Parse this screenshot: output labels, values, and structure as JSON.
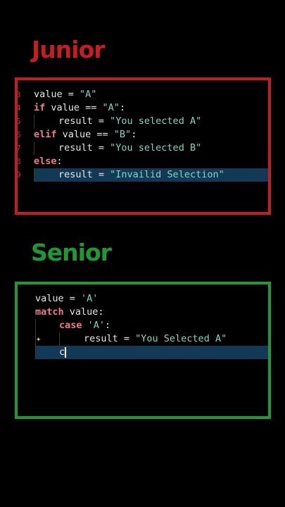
{
  "colors": {
    "junior": "#c61d25",
    "senior": "#1e9a35",
    "highlight": "#123a56"
  },
  "junior": {
    "heading": "Junior",
    "lines": [
      {
        "tokens": [
          {
            "t": "value",
            "c": "var"
          },
          {
            "t": " = ",
            "c": "op"
          },
          {
            "t": "\"A\"",
            "c": "str"
          }
        ]
      },
      {
        "tokens": [
          {
            "t": "if",
            "c": "kw"
          },
          {
            "t": " value == ",
            "c": "var"
          },
          {
            "t": "\"A\"",
            "c": "str"
          },
          {
            "t": ":",
            "c": "punct"
          }
        ]
      },
      {
        "tokens": [
          {
            "t": "result = ",
            "c": "var"
          },
          {
            "t": "\"You selected A\"",
            "c": "str"
          }
        ]
      },
      {
        "tokens": [
          {
            "t": "elif",
            "c": "kw"
          },
          {
            "t": " value == ",
            "c": "var"
          },
          {
            "t": "\"B\"",
            "c": "str"
          },
          {
            "t": ":",
            "c": "punct"
          }
        ]
      },
      {
        "tokens": [
          {
            "t": "result = ",
            "c": "var"
          },
          {
            "t": "\"You selected B\"",
            "c": "str"
          }
        ]
      },
      {
        "tokens": [
          {
            "t": "else",
            "c": "kw"
          },
          {
            "t": ":",
            "c": "punct"
          }
        ]
      },
      {
        "tokens": [
          {
            "t": "result = ",
            "c": "var"
          },
          {
            "t": "\"Invailid Selection\"",
            "c": "str"
          }
        ]
      }
    ]
  },
  "senior": {
    "heading": "Senior",
    "lines": [
      {
        "tokens": [
          {
            "t": "value",
            "c": "var"
          },
          {
            "t": " = ",
            "c": "op"
          },
          {
            "t": "'A'",
            "c": "str"
          }
        ]
      },
      {
        "tokens": [
          {
            "t": "match",
            "c": "kw"
          },
          {
            "t": " value:",
            "c": "var"
          }
        ]
      },
      {
        "tokens": [
          {
            "t": "case",
            "c": "kw"
          },
          {
            "t": " ",
            "c": "var"
          },
          {
            "t": "'A'",
            "c": "str"
          },
          {
            "t": ":",
            "c": "punct"
          }
        ]
      },
      {
        "tokens": [
          {
            "t": "result = ",
            "c": "var"
          },
          {
            "t": "\"You Selected A\"",
            "c": "str"
          }
        ]
      },
      {
        "tokens": [
          {
            "t": "c",
            "c": "var"
          }
        ]
      }
    ]
  }
}
